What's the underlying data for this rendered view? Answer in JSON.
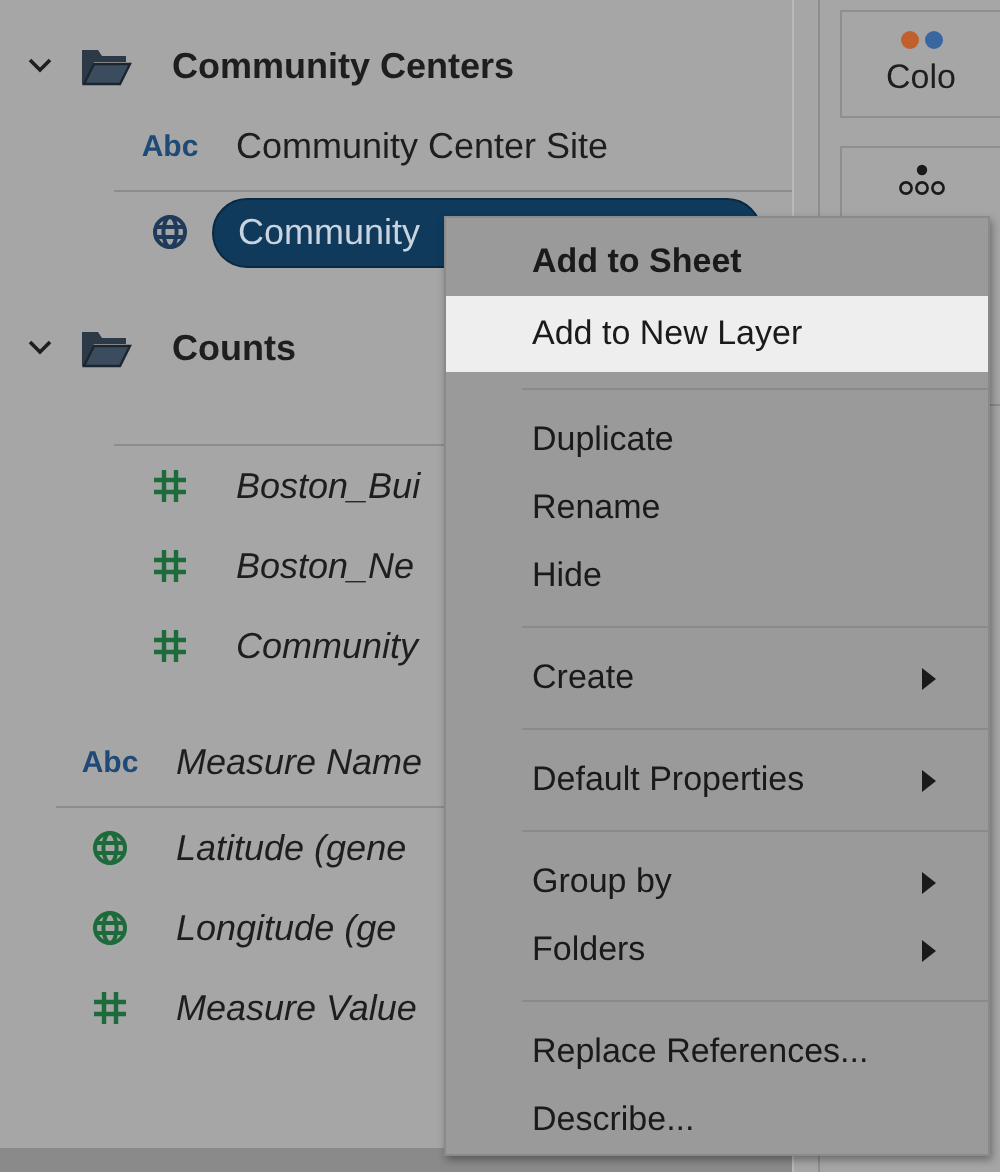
{
  "data_pane": {
    "groups": [
      {
        "name": "Community Centers",
        "expanded": true,
        "fields": [
          {
            "kind": "abc",
            "icon_label": "Abc",
            "color": "#1f4a78",
            "name": "Community Center Site",
            "italic": false,
            "selected": false,
            "divider_above": false
          },
          {
            "kind": "globe",
            "color": "#1f3a5a",
            "name": "Community",
            "italic": false,
            "selected": true,
            "divider_above": true
          }
        ]
      },
      {
        "name": "Counts",
        "expanded": true,
        "fields": [
          {
            "kind": "hash",
            "color": "#1d6b3a",
            "name": "Boston_Bui",
            "italic": true,
            "selected": false,
            "divider_above": true
          },
          {
            "kind": "hash",
            "color": "#1d6b3a",
            "name": "Boston_Ne",
            "italic": true,
            "selected": false,
            "divider_above": false
          },
          {
            "kind": "hash",
            "color": "#1d6b3a",
            "name": "Community",
            "italic": true,
            "selected": false,
            "divider_above": false
          }
        ]
      }
    ],
    "fields": [
      {
        "kind": "abc",
        "icon_label": "Abc",
        "color": "#1f4a78",
        "name": "Measure Name",
        "italic": true,
        "selected": false,
        "divider_above": false
      },
      {
        "kind": "globe",
        "color": "#1d6b3a",
        "name": "Latitude (gene",
        "italic": true,
        "selected": false,
        "divider_above": true
      },
      {
        "kind": "globe",
        "color": "#1d6b3a",
        "name": "Longitude (ge",
        "italic": true,
        "selected": false,
        "divider_above": false
      },
      {
        "kind": "hash",
        "color": "#1d6b3a",
        "name": "Measure Value",
        "italic": true,
        "selected": false,
        "divider_above": false
      }
    ]
  },
  "marks_card": {
    "buttons": [
      {
        "kind": "color",
        "label": "Colo"
      },
      {
        "kind": "detail"
      }
    ]
  },
  "context_menu": {
    "items": [
      {
        "kind": "item",
        "label": "Add to Sheet",
        "bold": true,
        "selected": false,
        "submenu": false
      },
      {
        "kind": "item",
        "label": "Add to New Layer",
        "bold": false,
        "selected": true,
        "submenu": false
      },
      {
        "kind": "separator"
      },
      {
        "kind": "item",
        "label": "Duplicate",
        "bold": false,
        "selected": false,
        "submenu": false
      },
      {
        "kind": "item",
        "label": "Rename",
        "bold": false,
        "selected": false,
        "submenu": false
      },
      {
        "kind": "item",
        "label": "Hide",
        "bold": false,
        "selected": false,
        "submenu": false
      },
      {
        "kind": "separator"
      },
      {
        "kind": "item",
        "label": "Create",
        "bold": false,
        "selected": false,
        "submenu": true
      },
      {
        "kind": "separator"
      },
      {
        "kind": "item",
        "label": "Default Properties",
        "bold": false,
        "selected": false,
        "submenu": true
      },
      {
        "kind": "separator"
      },
      {
        "kind": "item",
        "label": "Group by",
        "bold": false,
        "selected": false,
        "submenu": true
      },
      {
        "kind": "item",
        "label": "Folders",
        "bold": false,
        "selected": false,
        "submenu": true
      },
      {
        "kind": "separator"
      },
      {
        "kind": "item",
        "label": "Replace References...",
        "bold": false,
        "selected": false,
        "submenu": false
      },
      {
        "kind": "item",
        "label": "Describe...",
        "bold": false,
        "selected": false,
        "submenu": false
      }
    ]
  }
}
